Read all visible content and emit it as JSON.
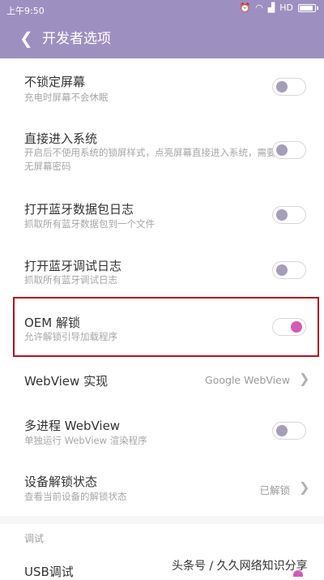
{
  "status_bar": {
    "time": "上午9:50",
    "network": "HD"
  },
  "header": {
    "back_icon": "chevron-left-icon",
    "title": "开发者选项"
  },
  "items": [
    {
      "title": "不锁定屏幕",
      "subtitle": "充电时屏幕不会休眠",
      "toggle": false
    },
    {
      "title": "直接进入系统",
      "subtitle": "开启后不使用系统的锁屏样式，点亮屏幕直接进入系统，需要无屏幕密码",
      "toggle": false
    },
    {
      "title": "打开蓝牙数据包日志",
      "subtitle": "抓取所有蓝牙数据包到一个文件",
      "toggle": false
    },
    {
      "title": "打开蓝牙调试日志",
      "subtitle": "抓取所有蓝牙调试日志",
      "toggle": false
    },
    {
      "title": "OEM 解锁",
      "subtitle": "允许解锁引导加载程序",
      "toggle": true
    },
    {
      "title": "WebView 实现",
      "value": "Google WebView"
    },
    {
      "title": "多进程 WebView",
      "subtitle": "单独运行 WebView 渲染程序",
      "toggle": false
    },
    {
      "title": "设备解锁状态",
      "subtitle": "查看当前设备的解锁状态",
      "value": "已解锁"
    }
  ],
  "section": {
    "label": "调试"
  },
  "usb_debug": {
    "title": "USB调试",
    "toggle": true
  },
  "watermark": "头条号 / 久久网络知识分享",
  "colors": {
    "header_bg": "#9d90c0",
    "toggle_on": "#d35ab8",
    "toggle_off_knob": "#a59eb6",
    "highlight_border": "#b3141b"
  }
}
